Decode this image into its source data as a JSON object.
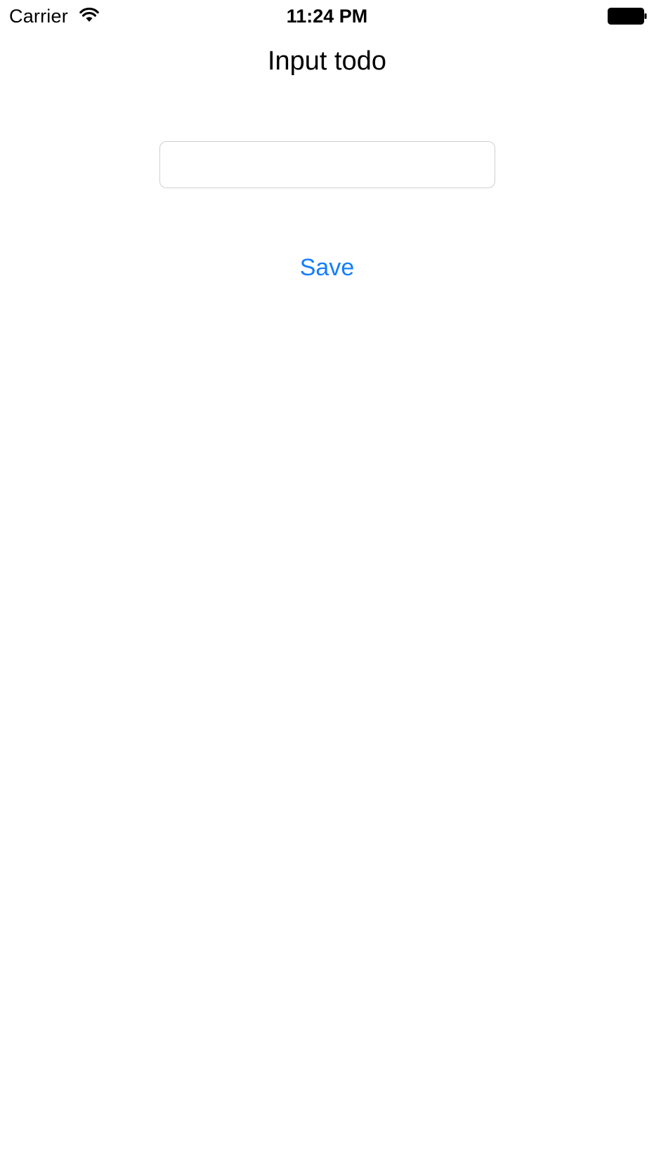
{
  "status_bar": {
    "carrier": "Carrier",
    "time": "11:24 PM",
    "wifi_icon": "wifi-icon",
    "battery_icon": "battery-full-icon"
  },
  "title": "Input todo",
  "todo_input": {
    "value": "",
    "placeholder": ""
  },
  "save_label": "Save",
  "colors": {
    "accent": "#147EFB",
    "text": "#000000",
    "background": "#FFFFFF",
    "input_border": "#CFCFCF"
  }
}
